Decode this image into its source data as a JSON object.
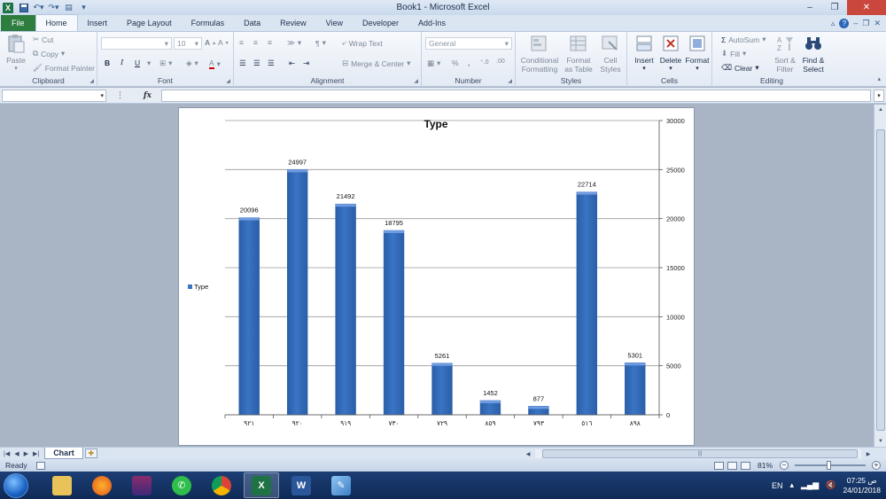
{
  "window": {
    "title": "Book1  -  Microsoft Excel",
    "app_letter": "X"
  },
  "ribbon_tabs": [
    "File",
    "Home",
    "Insert",
    "Page Layout",
    "Formulas",
    "Data",
    "Review",
    "View",
    "Developer",
    "Add-Ins"
  ],
  "ribbon": {
    "clipboard": {
      "paste": "Paste",
      "cut": "Cut",
      "copy": "Copy",
      "format_painter": "Format Painter",
      "label": "Clipboard"
    },
    "font": {
      "font_size": "10",
      "bold": "B",
      "italic": "I",
      "underline": "U",
      "label": "Font"
    },
    "alignment": {
      "wrap_text": "Wrap Text",
      "merge_center": "Merge & Center",
      "label": "Alignment"
    },
    "number": {
      "format": "General",
      "percent": "%",
      "comma": ",",
      "label": "Number"
    },
    "styles": {
      "conditional": "Conditional Formatting",
      "format_table": "Format as Table",
      "cell_styles": "Cell Styles",
      "label": "Styles"
    },
    "cells": {
      "insert": "Insert",
      "delete": "Delete",
      "format": "Format",
      "label": "Cells"
    },
    "editing": {
      "autosum": "AutoSum",
      "fill": "Fill",
      "clear": "Clear",
      "sort_filter": "Sort & Filter",
      "find_select": "Find & Select",
      "label": "Editing"
    }
  },
  "formula_bar": {
    "fx": "fx",
    "value": ""
  },
  "sheet_tabs": [
    "Chart"
  ],
  "status": {
    "ready": "Ready",
    "zoom": "81%"
  },
  "taskbar": {
    "language": "EN",
    "time": "07:25 ص",
    "date": "24/01/2018"
  },
  "colors": {
    "bar": "#3a74c4",
    "bar_dark": "#2a5ea8",
    "file_tab": "#2d7d3f"
  },
  "chart_data": {
    "type": "bar",
    "title": "Type",
    "categories": [
      "٩٢١",
      "٩٢٠",
      "٩١٩",
      "٧٣٠",
      "٧٢٩",
      "٨٥٩",
      "٧٩٣",
      "٥١٦",
      "٨٩٨"
    ],
    "series": [
      {
        "name": "Type",
        "values": [
          20096,
          24997,
          21492,
          18795,
          5261,
          1452,
          877,
          22714,
          5301
        ]
      }
    ],
    "y_ticks": [
      0,
      5000,
      10000,
      15000,
      20000,
      25000,
      30000
    ],
    "ylim": [
      0,
      30000
    ],
    "y_axis_side": "right",
    "grid": true,
    "legend_position": "left",
    "data_labels": true
  }
}
